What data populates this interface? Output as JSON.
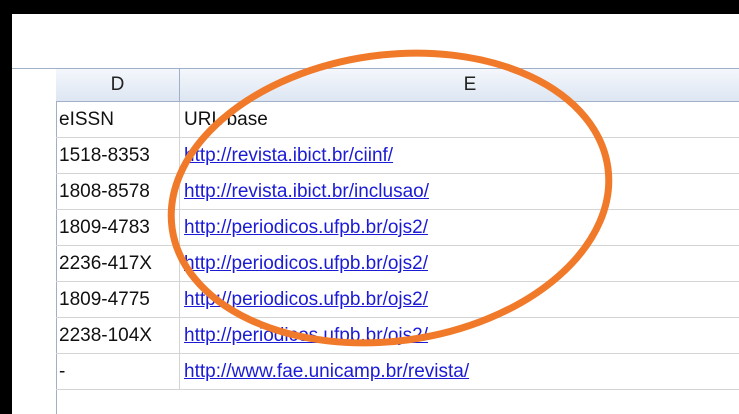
{
  "columns": {
    "d_header": "D",
    "e_header": "E"
  },
  "rows": [
    {
      "d": "eISSN",
      "e": "URL base",
      "e_is_link": false
    },
    {
      "d": "1518-8353",
      "e": "http://revista.ibict.br/ciinf/",
      "e_is_link": true
    },
    {
      "d": "1808-8578",
      "e": "http://revista.ibict.br/inclusao/",
      "e_is_link": true
    },
    {
      "d": "1809-4783",
      "e": "http://periodicos.ufpb.br/ojs2/",
      "e_is_link": true
    },
    {
      "d": "2236-417X",
      "e": "http://periodicos.ufpb.br/ojs2/",
      "e_is_link": true
    },
    {
      "d": "1809-4775",
      "e": "http://periodicos.ufpb.br/ojs2/",
      "e_is_link": true
    },
    {
      "d": "2238-104X",
      "e": "http://periodicos.ufpb.br/ojs2/",
      "e_is_link": true
    },
    {
      "d": "-",
      "e": "http://www.fae.unicamp.br/revista/",
      "e_is_link": true
    }
  ],
  "colors": {
    "annotation_ellipse": "#f07a2a",
    "link": "#1b1bd6"
  }
}
